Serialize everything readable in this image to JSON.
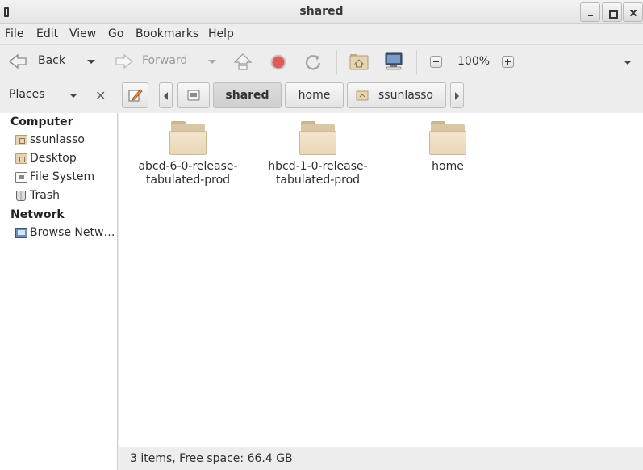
{
  "window": {
    "title": "shared"
  },
  "menubar": {
    "items": [
      "File",
      "Edit",
      "View",
      "Go",
      "Bookmarks",
      "Help"
    ]
  },
  "toolbar": {
    "back_label": "Back",
    "forward_label": "Forward",
    "zoom_level": "100%"
  },
  "places": {
    "label": "Places"
  },
  "location": {
    "breadcrumbs": [
      "shared",
      "home",
      "ssunlasso"
    ],
    "active": "shared"
  },
  "sidebar": {
    "computer_heading": "Computer",
    "computer_items": [
      {
        "label": "ssunlasso",
        "icon": "home-folder-icon"
      },
      {
        "label": "Desktop",
        "icon": "desktop-folder-icon"
      },
      {
        "label": "File System",
        "icon": "drive-icon"
      },
      {
        "label": "Trash",
        "icon": "trash-icon"
      }
    ],
    "network_heading": "Network",
    "network_items": [
      {
        "label": "Browse Netw…",
        "icon": "network-icon"
      }
    ]
  },
  "files": [
    {
      "line1": "abcd-6-0-release-",
      "line2": "tabulated-prod"
    },
    {
      "line1": "hbcd-1-0-release-",
      "line2": "tabulated-prod"
    },
    {
      "line1": "home",
      "line2": ""
    }
  ],
  "status": {
    "text": "3 items, Free space: 66.4 GB"
  }
}
